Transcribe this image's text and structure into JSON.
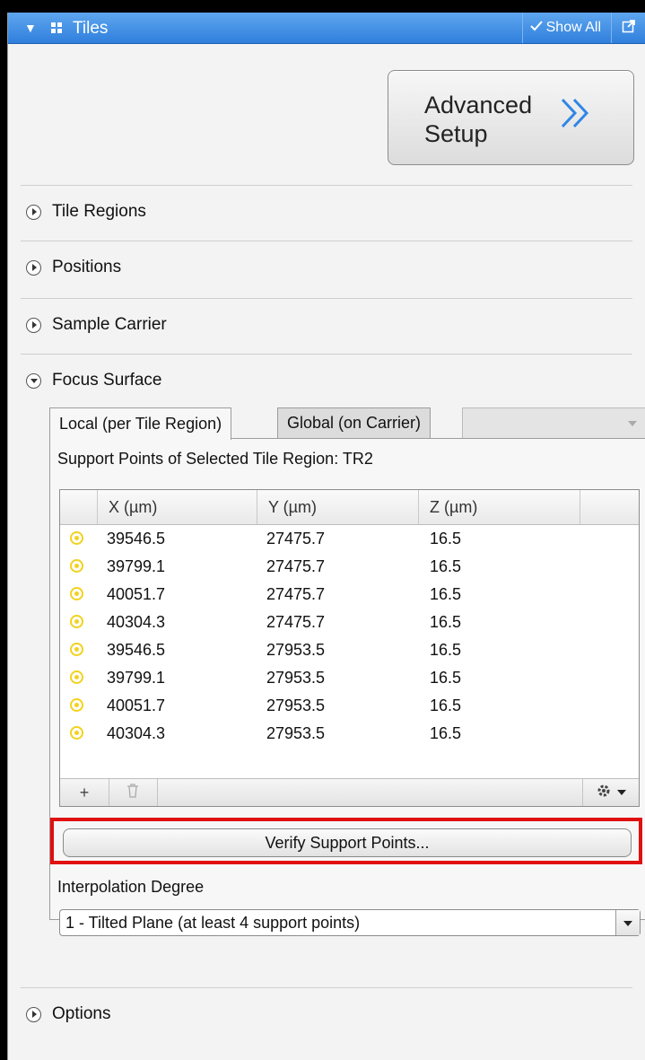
{
  "header": {
    "title": "Tiles",
    "show_all_label": "Show All"
  },
  "advanced_setup": {
    "label": "Advanced\nSetup"
  },
  "sections": [
    {
      "label": "Tile Regions",
      "expanded": false
    },
    {
      "label": "Positions",
      "expanded": false
    },
    {
      "label": "Sample Carrier",
      "expanded": false
    },
    {
      "label": "Focus Surface",
      "expanded": true
    },
    {
      "label": "Options",
      "expanded": false
    }
  ],
  "focus_surface": {
    "tabs": [
      {
        "label": "Local (per Tile Region)",
        "active": true
      },
      {
        "label": "Global (on Carrier)",
        "active": false
      }
    ],
    "support_points_label": "Support Points of Selected Tile Region:  TR2",
    "columns": [
      "X (µm)",
      "Y (µm)",
      "Z (µm)"
    ],
    "rows": [
      [
        "39546.5",
        "27475.7",
        "16.5"
      ],
      [
        "39799.1",
        "27475.7",
        "16.5"
      ],
      [
        "40051.7",
        "27475.7",
        "16.5"
      ],
      [
        "40304.3",
        "27475.7",
        "16.5"
      ],
      [
        "39546.5",
        "27953.5",
        "16.5"
      ],
      [
        "39799.1",
        "27953.5",
        "16.5"
      ],
      [
        "40051.7",
        "27953.5",
        "16.5"
      ],
      [
        "40304.3",
        "27953.5",
        "16.5"
      ]
    ],
    "add_label": "+",
    "verify_label": "Verify Support Points...",
    "interpolation_label": "Interpolation Degree",
    "interpolation_value": "1 - Tilted Plane (at least 4 support points)"
  },
  "colors": {
    "titlebar": "#3d8de3",
    "highlight": "#e01010",
    "point_icon": "#f2d21e"
  }
}
